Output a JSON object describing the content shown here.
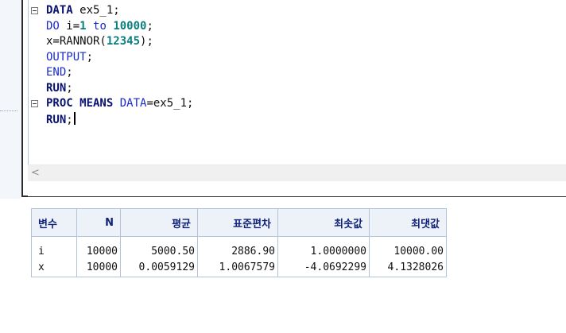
{
  "editor": {
    "lines": [
      {
        "fold": true,
        "tokens": [
          {
            "t": "DATA",
            "c": "kw"
          },
          {
            "t": " ex5_1;",
            "c": "txt"
          }
        ]
      },
      {
        "fold": false,
        "tokens": [
          {
            "t": "DO",
            "c": "kw2"
          },
          {
            "t": " i=",
            "c": "txt"
          },
          {
            "t": "1",
            "c": "num"
          },
          {
            "t": " to ",
            "c": "kw2"
          },
          {
            "t": "10000",
            "c": "num"
          },
          {
            "t": ";",
            "c": "txt"
          }
        ]
      },
      {
        "fold": false,
        "tokens": [
          {
            "t": "x=RANNOR(",
            "c": "txt"
          },
          {
            "t": "12345",
            "c": "num"
          },
          {
            "t": ");",
            "c": "txt"
          }
        ]
      },
      {
        "fold": false,
        "tokens": [
          {
            "t": "OUTPUT",
            "c": "kw2"
          },
          {
            "t": ";",
            "c": "txt"
          }
        ]
      },
      {
        "fold": false,
        "tokens": [
          {
            "t": "END",
            "c": "kw2"
          },
          {
            "t": ";",
            "c": "txt"
          }
        ]
      },
      {
        "fold": false,
        "tokens": [
          {
            "t": "RUN",
            "c": "kw"
          },
          {
            "t": ";",
            "c": "txt"
          }
        ]
      },
      {
        "fold": true,
        "tokens": [
          {
            "t": "PROC MEANS",
            "c": "kw"
          },
          {
            "t": " ",
            "c": "txt"
          },
          {
            "t": "DATA",
            "c": "kw2"
          },
          {
            "t": "=ex5_1;",
            "c": "txt"
          }
        ]
      },
      {
        "fold": false,
        "tokens": [
          {
            "t": "RUN",
            "c": "kw"
          },
          {
            "t": ";",
            "c": "txt"
          }
        ],
        "caret": true
      }
    ],
    "scroll_left_glyph": "<"
  },
  "results": {
    "columns": [
      "변수",
      "N",
      "평균",
      "표준편차",
      "최솟값",
      "최댓값"
    ],
    "rows": [
      [
        "i",
        "10000",
        "5000.50",
        "2886.90",
        "1.0000000",
        "10000.00"
      ],
      [
        "x",
        "10000",
        "0.0059129",
        "1.0067579",
        "-4.0692299",
        "4.1328026"
      ]
    ]
  }
}
